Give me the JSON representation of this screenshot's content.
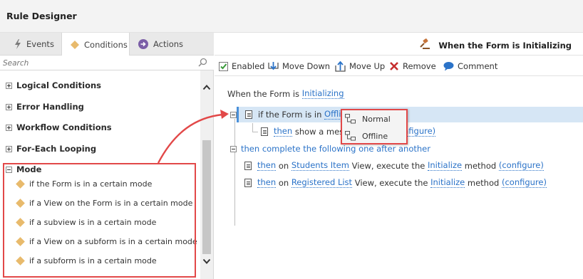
{
  "window": {
    "title": "Rule Designer"
  },
  "tabs": [
    {
      "label": "Events",
      "icon": "lightning-icon"
    },
    {
      "label": "Conditions",
      "icon": "diamond-icon",
      "active": true
    },
    {
      "label": "Actions",
      "icon": "arrow-circle-icon"
    }
  ],
  "search": {
    "placeholder": "Search"
  },
  "tree": {
    "groups": [
      {
        "label": "Logical Conditions",
        "expanded": false
      },
      {
        "label": "Error Handling",
        "expanded": false
      },
      {
        "label": "Workflow Conditions",
        "expanded": false
      },
      {
        "label": "For-Each Looping",
        "expanded": false
      },
      {
        "label": "Mode",
        "expanded": true
      }
    ],
    "mode_items": [
      "if the Form is in a certain mode",
      "if a View on the Form is in a certain mode",
      "if a subview is in a certain mode",
      "if a View on a subform is in a certain mode",
      "if a subform is in a certain mode"
    ]
  },
  "header": {
    "event_title": "When the Form is Initializing"
  },
  "toolbar": {
    "enabled": "Enabled",
    "move_down": "Move Down",
    "move_up": "Move Up",
    "remove": "Remove",
    "comment": "Comment"
  },
  "rule": {
    "event_prefix": "When the Form is ",
    "event_link": "Initializing",
    "cond_prefix": "if the Form is in ",
    "cond_link": "Offline",
    "then1_then": "then",
    "then1_text": " show a messa",
    "then1_config": "nfigure)",
    "complete_text": "then complete the following one after another",
    "a1_then": "then",
    "a1_on": " on ",
    "a1_view": "Students Item",
    "a1_mid": " View, execute the ",
    "a1_method": "Initialize",
    "a1_suffix": " method ",
    "a1_config": "(configure)",
    "a2_then": "then",
    "a2_on": " on ",
    "a2_view": "Registered List",
    "a2_mid": " View, execute the ",
    "a2_method": "Initialize",
    "a2_suffix": " method ",
    "a2_config": "(configure)"
  },
  "popup": {
    "options": [
      "Normal",
      "Offline"
    ]
  },
  "colors": {
    "accent_red": "#e24848",
    "link_blue": "#2b73c8",
    "diamond": "#e8ba6c",
    "selection": "#d6e6f5"
  }
}
